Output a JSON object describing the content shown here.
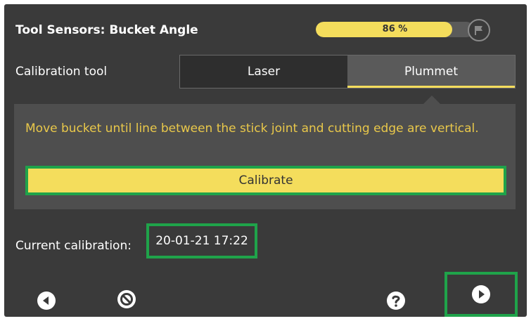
{
  "header": {
    "title": "Tool Sensors: Bucket Angle",
    "progress_value": 0.86,
    "progress_text": "86 %",
    "flag_icon": "flag-icon"
  },
  "calibration_tool": {
    "label": "Calibration tool",
    "options": [
      "Laser",
      "Plummet"
    ],
    "selected": "Plummet"
  },
  "instruction_panel": {
    "text": "Move bucket until line between the stick joint and cutting edge are vertical.",
    "calibrate_label": "Calibrate"
  },
  "current_calibration": {
    "label": "Current calibration:",
    "value": "20-01-21 17:22"
  },
  "footer": {
    "back_icon": "back-arrow-icon",
    "cancel_icon": "cancel-icon",
    "help_icon": "help-icon",
    "next_icon": "next-arrow-icon"
  },
  "colors": {
    "background": "#3a3a3a",
    "accent_yellow": "#f4dd5c",
    "instruction_text": "#e9c84a",
    "highlight_green": "#1fa34a"
  }
}
